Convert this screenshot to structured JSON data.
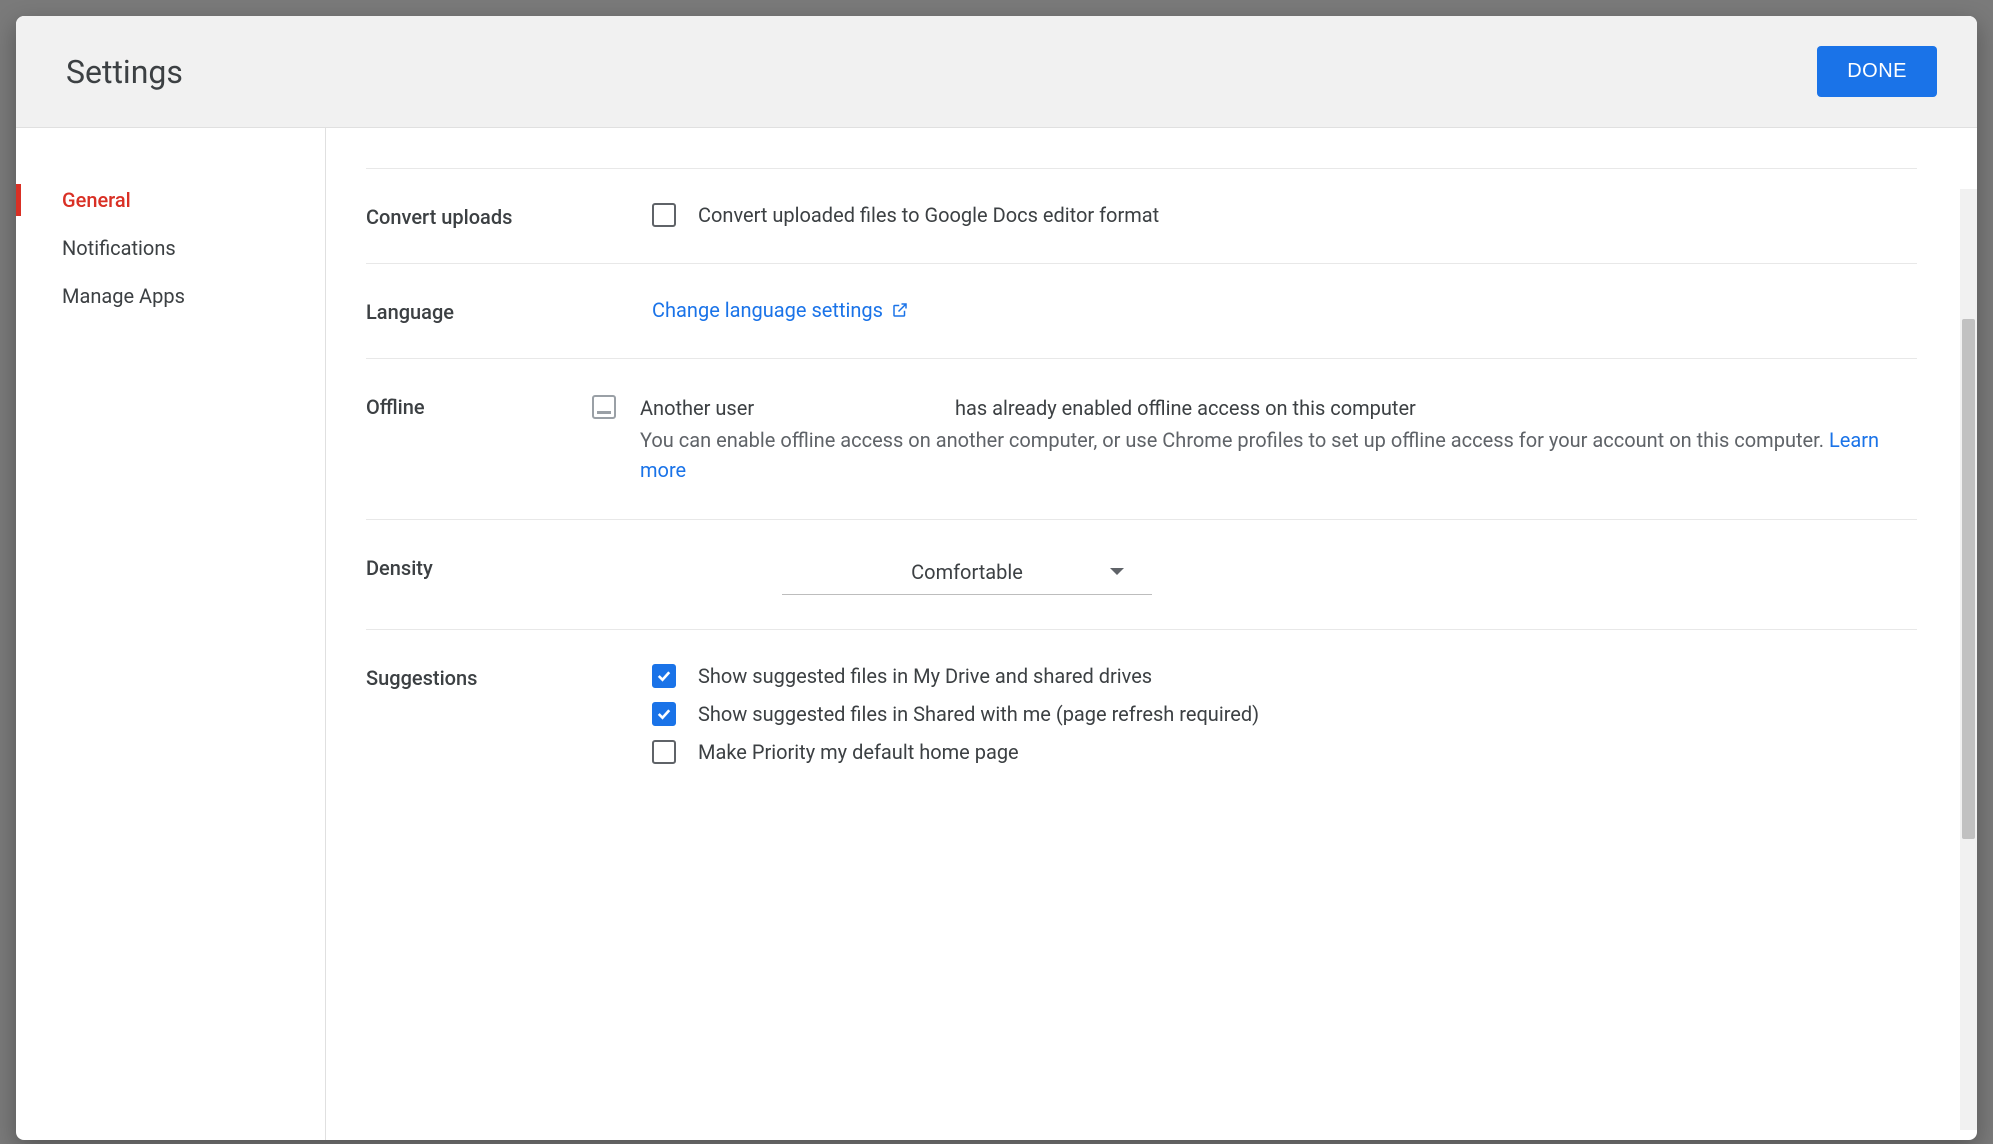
{
  "header": {
    "title": "Settings",
    "done": "DONE"
  },
  "sidebar": {
    "items": [
      {
        "label": "General",
        "active": true
      },
      {
        "label": "Notifications",
        "active": false
      },
      {
        "label": "Manage Apps",
        "active": false
      }
    ]
  },
  "sections": {
    "convert": {
      "label": "Convert uploads",
      "checkbox_label": "Convert uploaded files to Google Docs editor format",
      "checked": false
    },
    "language": {
      "label": "Language",
      "link": "Change language settings"
    },
    "offline": {
      "label": "Offline",
      "primary_prefix": "Another user",
      "primary_suffix": "has already enabled offline access on this computer",
      "secondary": "You can enable offline access on another computer, or use Chrome profiles to set up offline access for your account on this computer.",
      "learn_more": "Learn more"
    },
    "density": {
      "label": "Density",
      "value": "Comfortable"
    },
    "suggestions": {
      "label": "Suggestions",
      "items": [
        {
          "label": "Show suggested files in My Drive and shared drives",
          "checked": true
        },
        {
          "label": "Show suggested files in Shared with me (page refresh required)",
          "checked": true
        },
        {
          "label": "Make Priority my default home page",
          "checked": false
        }
      ]
    }
  }
}
